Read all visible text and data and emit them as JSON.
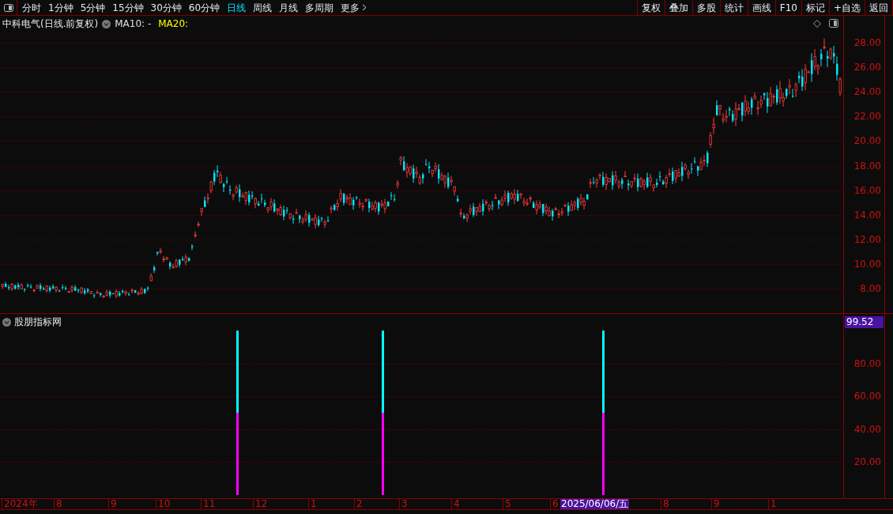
{
  "toolbar": {
    "tabs": [
      {
        "label": "分时",
        "selected": false
      },
      {
        "label": "1分钟",
        "selected": false
      },
      {
        "label": "5分钟",
        "selected": false
      },
      {
        "label": "15分钟",
        "selected": false
      },
      {
        "label": "30分钟",
        "selected": false
      },
      {
        "label": "60分钟",
        "selected": false
      },
      {
        "label": "日线",
        "selected": true
      },
      {
        "label": "周线",
        "selected": false
      },
      {
        "label": "月线",
        "selected": false
      },
      {
        "label": "多周期",
        "selected": false
      },
      {
        "label": "更多",
        "selected": false
      }
    ],
    "buttons": [
      "复权",
      "叠加",
      "多股",
      "统计",
      "画线",
      "F10",
      "标记",
      "+自选",
      "返回"
    ]
  },
  "main_panel": {
    "title": "中科电气(日线.前复权)",
    "indicators": [
      {
        "label": "MA10: -",
        "color": "#e0e0e0"
      },
      {
        "label": "MA20:",
        "color": "#ffff00"
      }
    ],
    "y_axis": [
      "28.00",
      "26.00",
      "24.00",
      "22.00",
      "20.00",
      "18.00",
      "16.00",
      "14.00",
      "12.00",
      "10.00",
      "8.00"
    ]
  },
  "indicator_panel": {
    "title": "股朋指标网",
    "current_value": "99.52",
    "y_axis": [
      "80.00",
      "60.00",
      "40.00",
      "20.00"
    ]
  },
  "date_axis": {
    "labels": [
      {
        "text": "2024年",
        "highlighted": false
      },
      {
        "text": "8",
        "highlighted": false
      },
      {
        "text": "9",
        "highlighted": false
      },
      {
        "text": "10",
        "highlighted": false
      },
      {
        "text": "11",
        "highlighted": false
      },
      {
        "text": "12",
        "highlighted": false
      },
      {
        "text": "1",
        "highlighted": false
      },
      {
        "text": "2",
        "highlighted": false
      },
      {
        "text": "3",
        "highlighted": false
      },
      {
        "text": "4",
        "highlighted": false
      },
      {
        "text": "5",
        "highlighted": false
      },
      {
        "text": "6",
        "highlighted": false
      },
      {
        "text": "2025/06/06/五",
        "highlighted": true
      },
      {
        "text": "8",
        "highlighted": false
      },
      {
        "text": "9",
        "highlighted": false
      },
      {
        "text": "1",
        "highlighted": false
      }
    ]
  }
}
